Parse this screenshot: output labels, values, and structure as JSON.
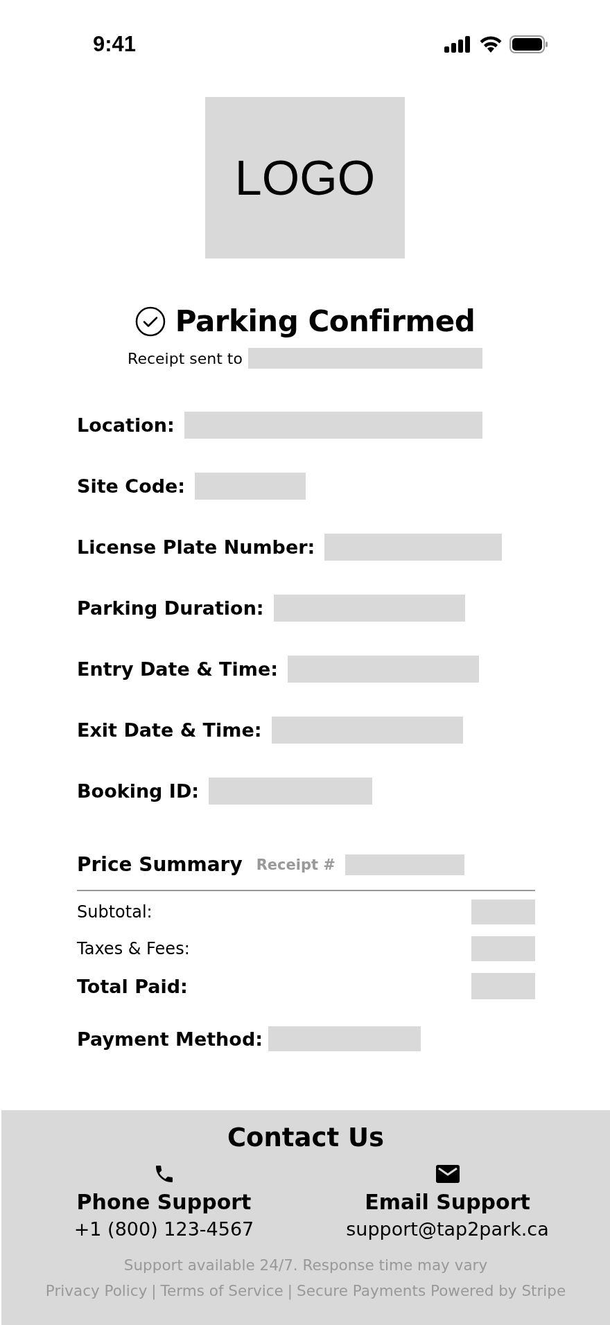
{
  "status_bar": {
    "time": "9:41"
  },
  "logo": {
    "text": "LOGO"
  },
  "header": {
    "title": "Parking Confirmed",
    "receipt_label": "Receipt sent to"
  },
  "details": [
    {
      "label": "Location:"
    },
    {
      "label": "Site Code:"
    },
    {
      "label": "License Plate Number:"
    },
    {
      "label": "Parking Duration:"
    },
    {
      "label": "Entry Date & Time:"
    },
    {
      "label": "Exit Date & Time:"
    },
    {
      "label": "Booking ID:"
    }
  ],
  "price_summary": {
    "title": "Price Summary",
    "receipt_label": "Receipt #",
    "lines": [
      {
        "label": "Subtotal:",
        "kind": "regular"
      },
      {
        "label": "Taxes & Fees:",
        "kind": "regular"
      },
      {
        "label": "Total Paid:",
        "kind": "total"
      }
    ],
    "payment_label": "Payment Method:"
  },
  "contact": {
    "title": "Contact Us",
    "channels": [
      {
        "kind": "phone",
        "title": "Phone Support",
        "value": "+1 (800) 123-4567"
      },
      {
        "kind": "email",
        "title": "Email Support",
        "value": "support@tap2park.ca"
      }
    ],
    "note": "Support available 24/7. Response time may vary",
    "links": [
      "Privacy Policy",
      "Terms of Service",
      "Secure Payments Powered by Stripe"
    ],
    "separator": "|"
  }
}
